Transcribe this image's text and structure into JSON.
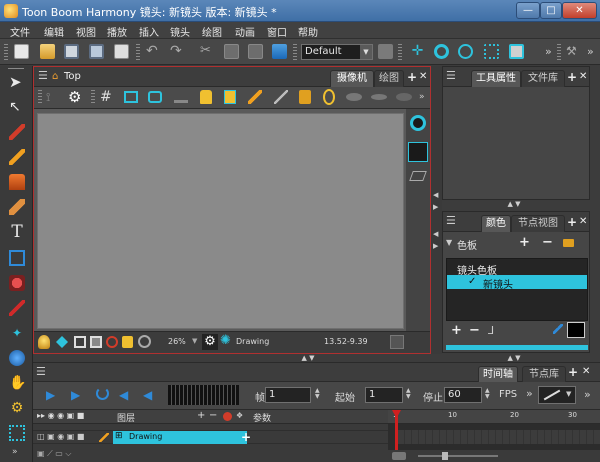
{
  "window": {
    "title": "Toon Boom Harmony 镜头: 新镜头 版本: 新镜头 *",
    "min_label": "—",
    "max_label": "□",
    "close_label": "✕"
  },
  "menu": [
    "文件",
    "编辑",
    "视图",
    "播放",
    "插入",
    "镜头",
    "绘图",
    "动画",
    "窗口",
    "帮助"
  ],
  "toolbar": {
    "workspace_value": "Default",
    "overflow": "»"
  },
  "left_tools": [
    "select-arrow-icon",
    "transform-arrow-icon",
    "brush-icon",
    "pencil-icon",
    "stamp-icon",
    "eraser-icon",
    "text-icon",
    "rectangle-icon",
    "paint-bucket-icon",
    "eyedropper-icon",
    "pivot-icon",
    "globe-icon",
    "hand-icon",
    "rig-icon",
    "grid-icon"
  ],
  "viewport": {
    "breadcrumb": "Top",
    "tab_camera": "摄像机",
    "tab_drawing": "绘图",
    "zoom": "26%",
    "drawing_label": "Drawing",
    "coords": "13.52-9.39"
  },
  "tool_props_panel": {
    "tab_props": "工具属性",
    "tab_library": "文件库"
  },
  "color_panel": {
    "tab_color": "颜色",
    "tab_node": "节点视图",
    "palette_header": "色板",
    "palette_group": "镜头色板",
    "palette_item": "新镜头",
    "swatch_color": "#000000"
  },
  "timeline": {
    "tab_timeline": "时间轴",
    "tab_node_lib": "节点库",
    "frame_label": "帧",
    "frame_value": "1",
    "start_label": "起始",
    "start_value": "1",
    "stop_label": "停止",
    "stop_value": "60",
    "fps_label": "FPS",
    "layer_col": "图层",
    "params_col": "参数",
    "layer_name": "Drawing",
    "ruler": [
      "1",
      "10",
      "20",
      "30"
    ]
  },
  "colors": {
    "accent_cyan": "#2ec3dd",
    "highlight_red": "#b03030",
    "title_blue": "#4f7bb0"
  }
}
